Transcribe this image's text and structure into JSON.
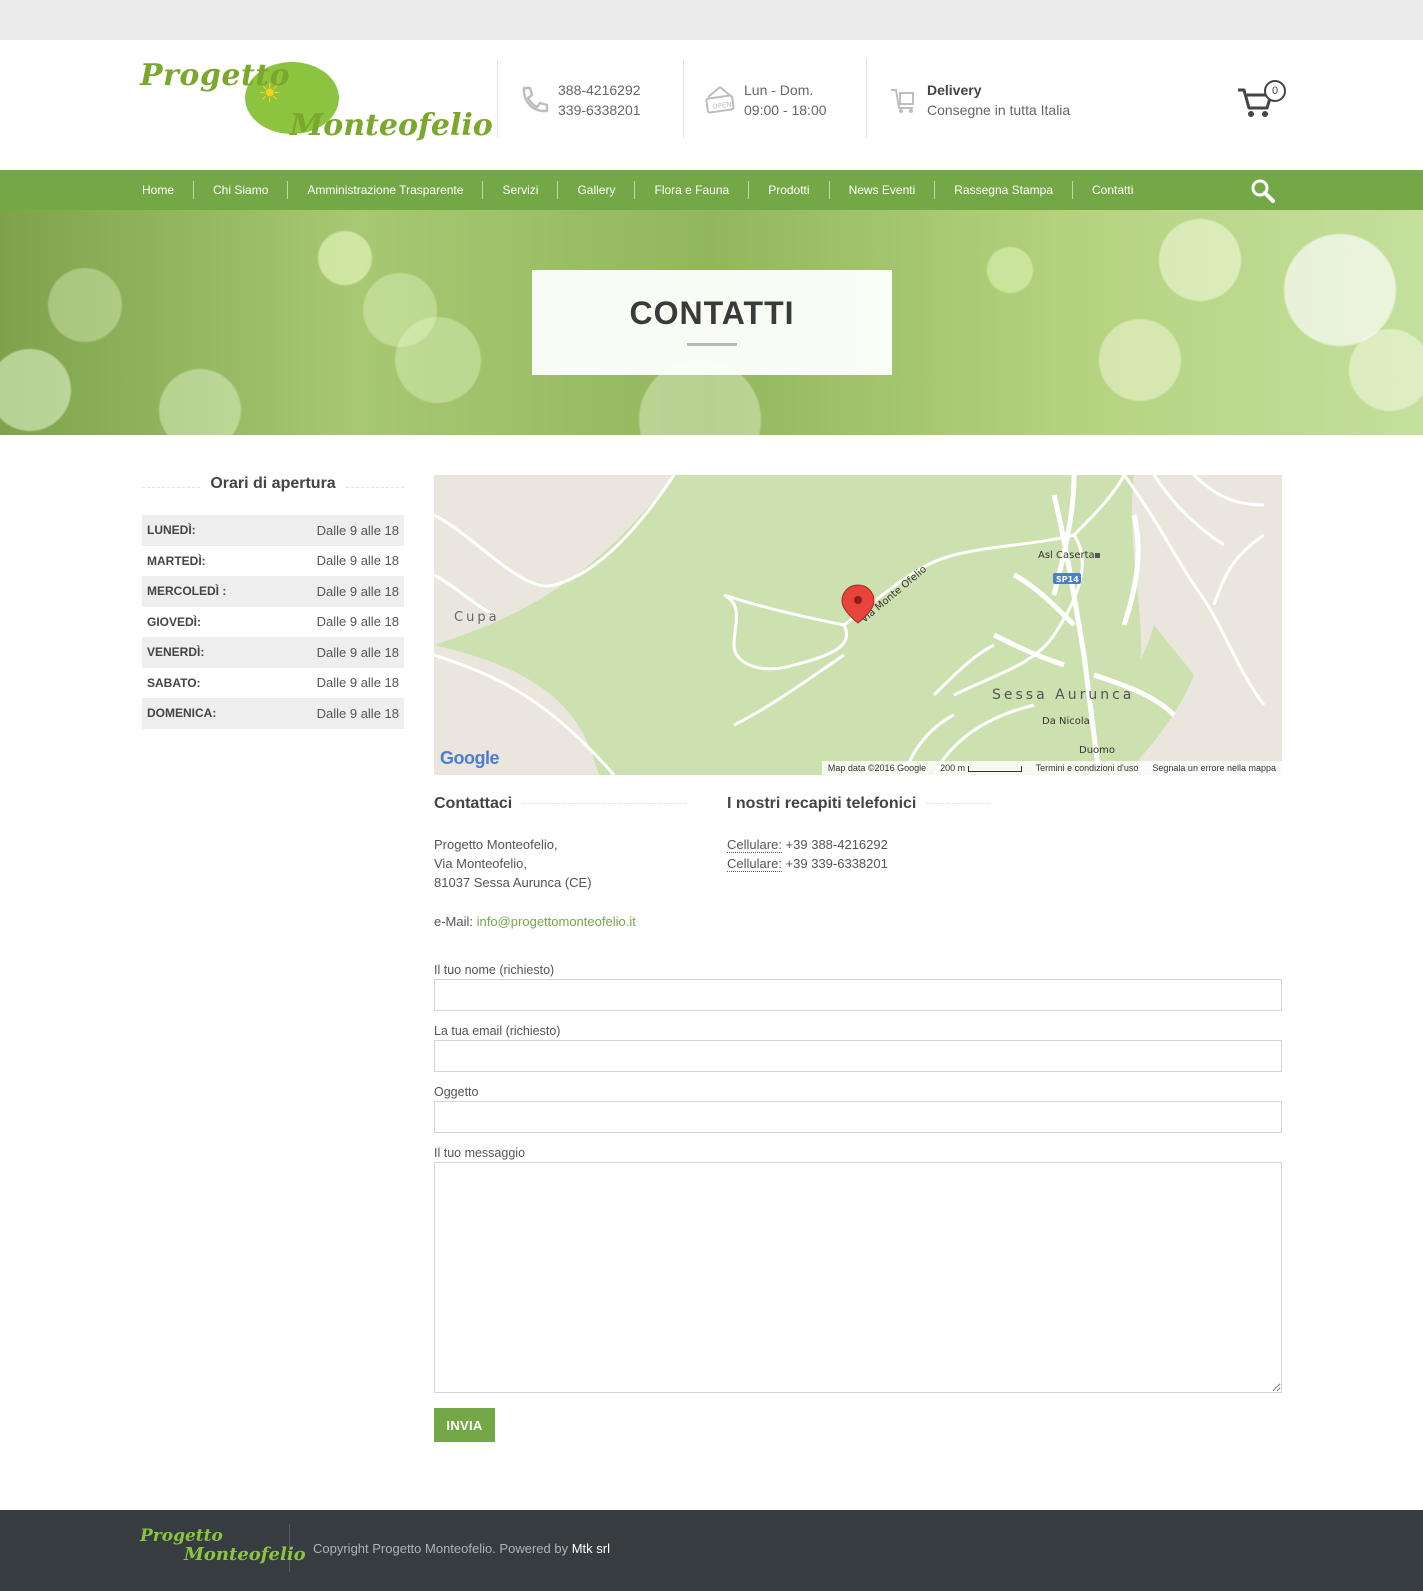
{
  "header": {
    "logo_line1": "Progetto",
    "logo_line2": "Monteofelio",
    "phone": {
      "icon": "phone-icon",
      "line1": "388-4216292",
      "line2": "339-6338201"
    },
    "hours": {
      "icon": "open-sign-icon",
      "line1": "Lun - Dom.",
      "line2": "09:00 - 18:00"
    },
    "delivery": {
      "icon": "delivery-cart-icon",
      "title": "Delivery",
      "subtitle": "Consegne in tutta Italia"
    },
    "cart": {
      "icon": "cart-icon",
      "count": "0"
    }
  },
  "nav": {
    "items": [
      "Home",
      "Chi Siamo",
      "Amministrazione Trasparente",
      "Servizi",
      "Gallery",
      "Flora e Fauna",
      "Prodotti",
      "News Eventi",
      "Rassegna Stampa",
      "Contatti"
    ],
    "search_icon": "search-icon"
  },
  "hero": {
    "title": "CONTATTI"
  },
  "sidebar": {
    "heading": "Orari di apertura",
    "hours": [
      {
        "day": "LUNEDÌ:",
        "time": "Dalle 9 alle 18"
      },
      {
        "day": "MARTEDÌ:",
        "time": "Dalle 9 alle 18"
      },
      {
        "day": "MERCOLEDÌ :",
        "time": "Dalle 9 alle 18"
      },
      {
        "day": "GIOVEDÌ:",
        "time": "Dalle 9 alle 18"
      },
      {
        "day": "VENERDÌ:",
        "time": "Dalle 9 alle 18"
      },
      {
        "day": "SABATO:",
        "time": "Dalle 9 alle 18"
      },
      {
        "day": "DOMENICA:",
        "time": "Dalle 9 alle 18"
      }
    ]
  },
  "map": {
    "labels": {
      "cupa": "Cupa",
      "street": "Via Monte Ofelio",
      "asl": "Asl Caserta",
      "sp14": "SP14",
      "town": "Sessa Aurunca",
      "restaurant": "Da Nicola",
      "duomo": "Duomo"
    },
    "google": "Google",
    "attribution": "Map data ©2016 Google",
    "scale": "200 m",
    "terms": "Termini e condizioni d'uso",
    "report": "Segnala un errore nella mappa"
  },
  "contact": {
    "heading": "Contattaci",
    "address_line1": "Progetto Monteofelio,",
    "address_line2": "Via Monteofelio,",
    "address_line3": "81037 Sessa Aurunca (CE)",
    "email_label": "e-Mail:",
    "email": "info@progettomonteofelio.it"
  },
  "phones": {
    "heading": "I nostri recapiti telefonici",
    "label": "Cellulare:",
    "number1": "+39 388-4216292",
    "number2": "+39 339-6338201"
  },
  "form": {
    "name_label": "Il tuo nome (richiesto)",
    "email_label": "La tua email (richiesto)",
    "subject_label": "Oggetto",
    "message_label": "Il tuo messaggio",
    "submit_label": "INVIA"
  },
  "footer": {
    "logo_line1": "Progetto",
    "logo_line2": "Monteofelio",
    "copyright": "Copyright Progetto Monteofelio. Powered by",
    "powered_by": "Mtk srl"
  },
  "colors": {
    "accent": "#74a847",
    "footer_bg": "#373c40",
    "topbar_bg": "#ebebeb"
  }
}
